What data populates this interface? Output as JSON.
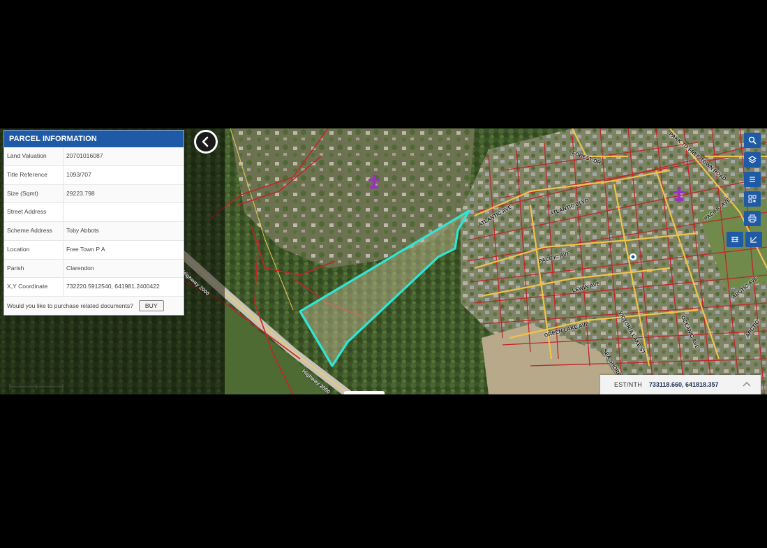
{
  "panel": {
    "title": "PARCEL INFORMATION",
    "rows": [
      {
        "label": "Land Valuation",
        "value": "20701016087"
      },
      {
        "label": "Title Reference",
        "value": "1093/707"
      },
      {
        "label": "Size (Sqmt)",
        "value": "29223.798"
      },
      {
        "label": "Street Address",
        "value": ""
      },
      {
        "label": "Scheme Address",
        "value": "Toby Abbots"
      },
      {
        "label": "Location",
        "value": "Free Town P A"
      },
      {
        "label": "Parish",
        "value": "Clarendon"
      },
      {
        "label": "X,Y Coordinate",
        "value": "732220.5912540,  641981.2400422"
      }
    ],
    "purchase_prompt": "Would you like to purchase related documents?",
    "buy_label": "BUY"
  },
  "coordinates": {
    "label": "EST/NTH",
    "value": "733118.660, 641818.357"
  },
  "road_labels": {
    "highway_2000_a": "Highway 2000",
    "highway_2000_b": "Highway 2000",
    "forest_dr": "FOREST DR",
    "free_town_road": "PARK TO FREE TOWN ROAD",
    "atlantic_ave": "ATLANTIC AVE",
    "atlantic_blvd": "ATLANTIC BLVD",
    "pacific_ave": "PACIFIC AVE",
    "pacific_ave_2": "PACIFIC AVE",
    "lewin_ave": "LEWIN AVE",
    "green_lake_ave": "GREEN LAKE AVE",
    "victoria_lake_st": "VICTORIA LAKE ST",
    "oceanic_ave": "OCEANIC AVE",
    "sea_shore": "SEA SHORE",
    "arctic": "ARCTIC",
    "arctic_ave": "ARCTIC AVE"
  },
  "icons": {
    "back": "chevron-left-icon",
    "search": "search-icon",
    "layers": "layers-icon",
    "menu": "menu-icon",
    "qr": "qr-code-icon",
    "print": "printer-icon",
    "basemap": "basemap-icon",
    "measure": "measure-icon",
    "coord_toggle": "chevron-up-icon",
    "landmark": "church-icon"
  },
  "colors": {
    "panel_header": "#1f5aa6",
    "parcel_outline": "#2fe6d6",
    "parcel_lines": "#c0262b",
    "roads": "#f0c34a",
    "landmark": "#9b2fc2"
  }
}
